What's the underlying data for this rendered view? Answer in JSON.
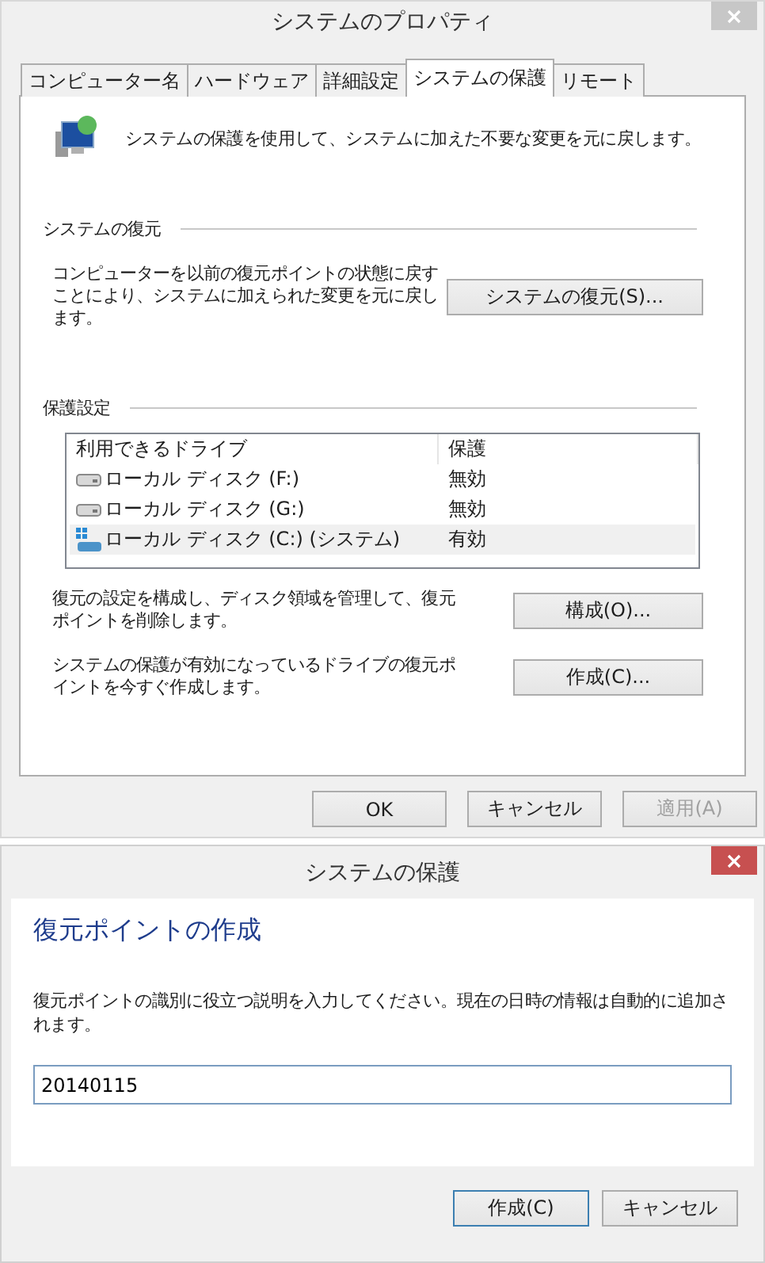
{
  "properties_window": {
    "title": "システムのプロパティ",
    "tabs": [
      {
        "label": "コンピューター名",
        "selected": false
      },
      {
        "label": "ハードウェア",
        "selected": false
      },
      {
        "label": "詳細設定",
        "selected": false
      },
      {
        "label": "システムの保護",
        "selected": true
      },
      {
        "label": "リモート",
        "selected": false
      }
    ],
    "intro": "システムの保護を使用して、システムに加えた不要な変更を元に戻します。",
    "restore_section": {
      "heading": "システムの復元",
      "description": "コンピューターを以前の復元ポイントの状態に戻すことにより、システムに加えられた変更を元に戻します。",
      "button": "システムの復元(S)..."
    },
    "protection_section": {
      "heading": "保護設定",
      "columns": [
        "利用できるドライブ",
        "保護"
      ],
      "rows": [
        {
          "kind": "drive",
          "drive": "ローカル ディスク (F:)",
          "protection": "無効",
          "selected": false
        },
        {
          "kind": "drive",
          "drive": "ローカル ディスク (G:)",
          "protection": "無効",
          "selected": false
        },
        {
          "kind": "system",
          "drive": "ローカル ディスク (C:) (システム)",
          "protection": "有効",
          "selected": true
        }
      ],
      "actions": [
        {
          "description": "復元の設定を構成し、ディスク領域を管理して、復元ポイントを削除します。",
          "button": "構成(O)..."
        },
        {
          "description": "システムの保護が有効になっているドライブの復元ポイントを今すぐ作成します。",
          "button": "作成(C)..."
        }
      ]
    },
    "buttons": [
      {
        "label": "OK",
        "disabled": false
      },
      {
        "label": "キャンセル",
        "disabled": false
      },
      {
        "label": "適用(A)",
        "disabled": true
      }
    ]
  },
  "protection_dialog": {
    "title": "システムの保護",
    "heading": "復元ポイントの作成",
    "instruction": "復元ポイントの識別に役立つ説明を入力してください。現在の日時の情報は自動的に追加されます。",
    "description_value": "20140115",
    "buttons": [
      {
        "label": "作成(C)",
        "default": true
      },
      {
        "label": "キャンセル",
        "default": false
      }
    ]
  }
}
